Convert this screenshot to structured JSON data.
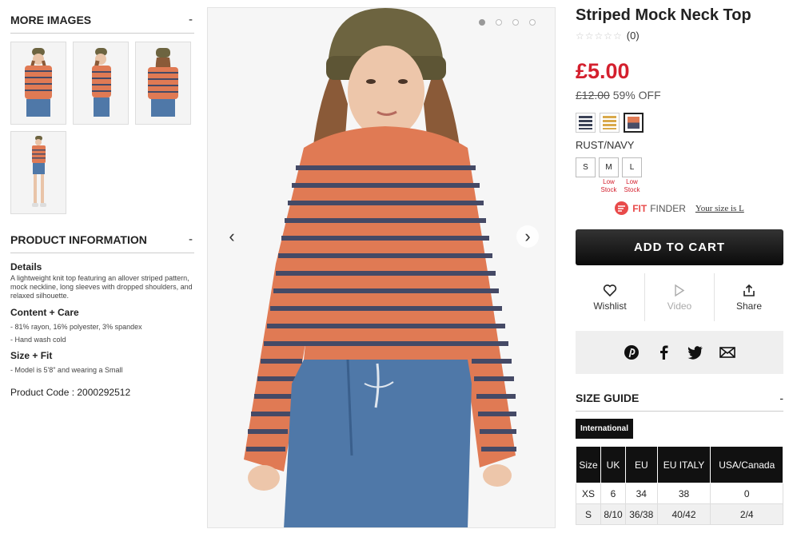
{
  "more_images": {
    "heading": "MORE IMAGES",
    "toggle": "-",
    "thumbnails": [
      "front view",
      "side view",
      "back view",
      "full length view"
    ]
  },
  "product_info": {
    "heading": "PRODUCT INFORMATION",
    "toggle": "-",
    "details_title": "Details",
    "details_text": "A lightweight knit top featuring an allover striped pattern, mock neckline, long sleeves with dropped shoulders, and relaxed silhouette.",
    "content_title": "Content + Care",
    "content_lines": [
      "- 81% rayon, 16% polyester, 3% spandex",
      "- Hand wash cold"
    ],
    "size_title": "Size + Fit",
    "size_lines": [
      "- Model is 5'8\" and wearing a Small"
    ],
    "code_label": "Product Code : 2000292512"
  },
  "gallery": {
    "prev_icon": "chevron-left-icon",
    "next_icon": "chevron-right-icon",
    "dots": 4,
    "active_dot": 1
  },
  "product": {
    "title": "Striped Mock Neck Top",
    "stars": "☆☆☆☆☆",
    "review_count": "(0)",
    "price": "£5.00",
    "old_price": "£12.00",
    "discount": "59% OFF",
    "swatches": [
      {
        "name": "navy stripe",
        "color": "#3b4256",
        "accent": "#ffffff",
        "selected": false
      },
      {
        "name": "mustard stripe",
        "color": "#d9a94a",
        "accent": "#ffffff",
        "selected": false
      },
      {
        "name": "rust/navy",
        "color": "#e07a54",
        "accent": "#4a4e68",
        "selected": true
      }
    ],
    "color_name": "RUST/NAVY",
    "sizes": [
      {
        "label": "S",
        "note": ""
      },
      {
        "label": "M",
        "note": "Low Stock"
      },
      {
        "label": "L",
        "note": "Low Stock"
      }
    ],
    "fit_fit": "FIT",
    "fit_finder": "FINDER",
    "fit_link": "Your size is L",
    "add_to_cart": "ADD TO CART",
    "actions": {
      "wishlist": "Wishlist",
      "video": "Video",
      "share": "Share"
    },
    "social": [
      "pinterest-icon",
      "facebook-icon",
      "twitter-icon",
      "email-icon"
    ]
  },
  "size_guide": {
    "heading": "SIZE GUIDE",
    "toggle": "-",
    "tab": "International",
    "headers": [
      "Size",
      "UK",
      "EU",
      "EU ITALY",
      "USA/Canada"
    ],
    "rows": [
      [
        "XS",
        "6",
        "34",
        "38",
        "0"
      ],
      [
        "S",
        "8/10",
        "36/38",
        "40/42",
        "2/4"
      ]
    ]
  },
  "colors": {
    "price_red": "#d4202e",
    "stripe_rust": "#e07a54",
    "stripe_navy": "#454a66",
    "denim": "#4f78a8"
  }
}
